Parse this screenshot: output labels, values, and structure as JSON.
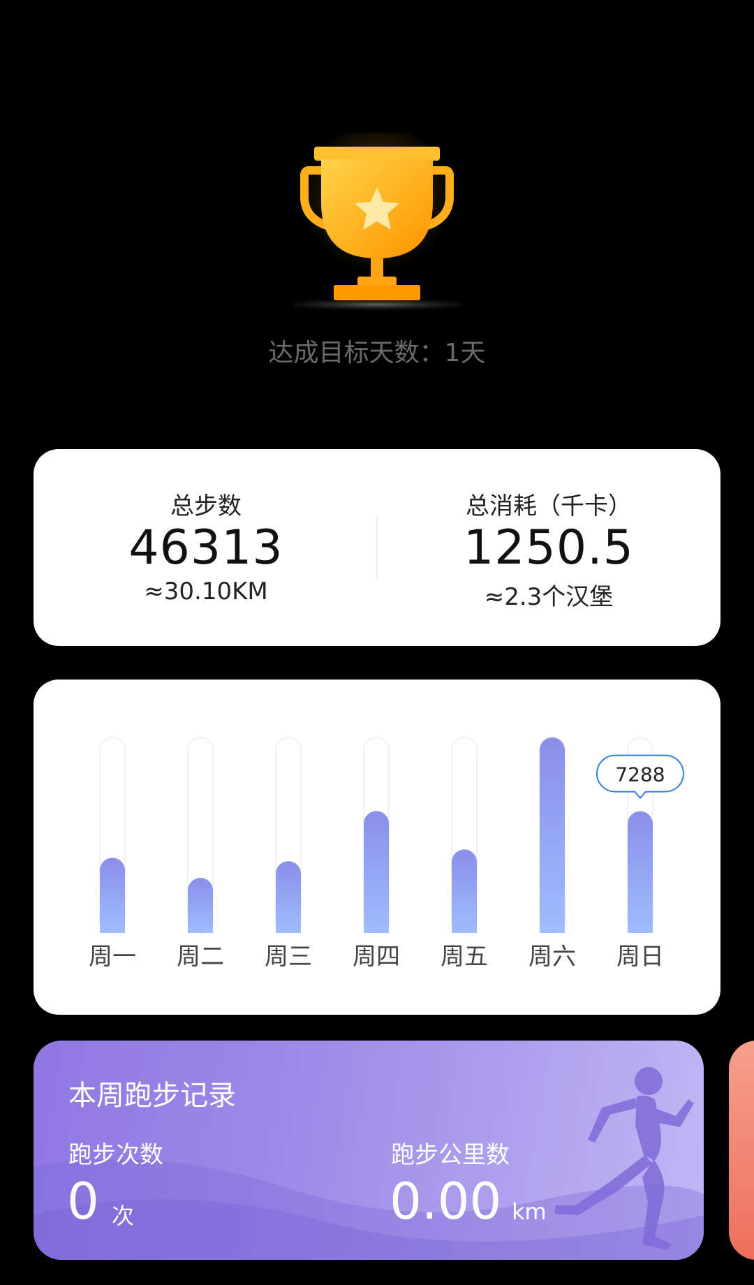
{
  "trophy": {
    "icon": "trophy-star-icon",
    "goal_text": "达成目标天数：1天"
  },
  "summary": {
    "steps_label": "总步数",
    "steps_value": "46313",
    "steps_sub": "≈30.10KM",
    "calories_label": "总消耗（千卡）",
    "calories_value": "1250.5",
    "calories_sub": "≈2.3个汉堡"
  },
  "chart_data": {
    "type": "bar",
    "categories": [
      "周一",
      "周二",
      "周三",
      "周四",
      "周五",
      "周六",
      "周日"
    ],
    "values": [
      4500,
      3300,
      4300,
      7300,
      5000,
      11700,
      7288
    ],
    "ylim": [
      0,
      11700
    ],
    "highlight": {
      "category": "周日",
      "label": "7288"
    },
    "colors": {
      "bar_top": "#8a8ee8",
      "bar_bottom": "#9fbdff",
      "track": "#f0f0f0",
      "bubble": "#2f7fe0"
    }
  },
  "running": {
    "title": "本周跑步记录",
    "count_label": "跑步次数",
    "count_value": "0",
    "count_unit": "次",
    "distance_label": "跑步公里数",
    "distance_value": "0.00",
    "distance_unit": "km",
    "icon": "runner-icon"
  }
}
